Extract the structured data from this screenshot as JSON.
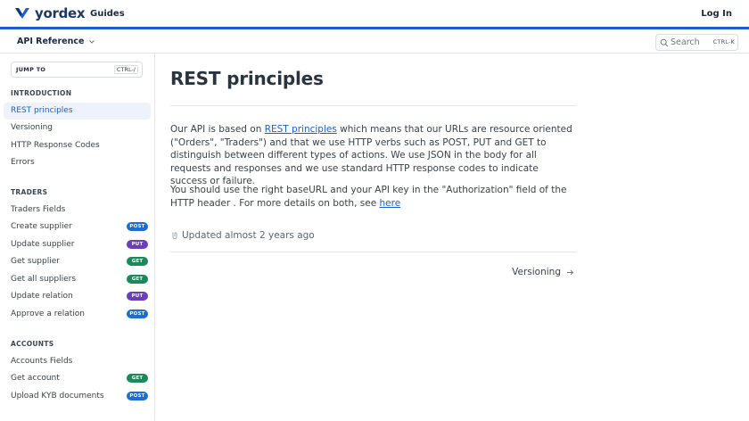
{
  "header": {
    "brand": "yordex",
    "guides_label": "Guides",
    "login_label": "Log In",
    "accent_color": "#1a5fd0"
  },
  "subheader": {
    "api_reference_label": "API Reference",
    "search_label": "Search",
    "search_shortcut": "CTRL-K"
  },
  "sidebar": {
    "jump_to_label": "JUMP TO",
    "jump_to_shortcut": "CTRL-/",
    "sections": [
      {
        "title": "INTRODUCTION",
        "items": [
          {
            "label": "REST principles",
            "active": true
          },
          {
            "label": "Versioning"
          },
          {
            "label": "HTTP Response Codes"
          },
          {
            "label": "Errors"
          }
        ]
      },
      {
        "title": "TRADERS",
        "items": [
          {
            "label": "Traders Fields"
          },
          {
            "label": "Create supplier",
            "method": "POST"
          },
          {
            "label": "Update supplier",
            "method": "PUT"
          },
          {
            "label": "Get supplier",
            "method": "GET"
          },
          {
            "label": "Get all suppliers",
            "method": "GET"
          },
          {
            "label": "Update relation",
            "method": "PUT"
          },
          {
            "label": "Approve a relation",
            "method": "POST"
          }
        ]
      },
      {
        "title": "ACCOUNTS",
        "items": [
          {
            "label": "Accounts Fields"
          },
          {
            "label": "Get account",
            "method": "GET"
          },
          {
            "label": "Upload KYB documents",
            "method": "POST"
          }
        ]
      }
    ]
  },
  "main": {
    "title": "REST principles",
    "para1_prefix": "Our API is based on ",
    "para1_link": "REST principles",
    "para1_suffix": " which means that our URLs are resource oriented (\"Orders\", \"Traders\") and that we use HTTP verbs such as POST, PUT and GET to distinguish between different types of actions. We use JSON in the body for all requests and responses and we use standard HTTP response codes to indicate success or failure.",
    "para2_prefix": "You should use the right baseURL and your API key in the \"Authorization\" field of the HTTP header . For more details on both, see ",
    "para2_link": "here",
    "updated": "Updated almost 2 years ago",
    "next_label": "Versioning"
  }
}
